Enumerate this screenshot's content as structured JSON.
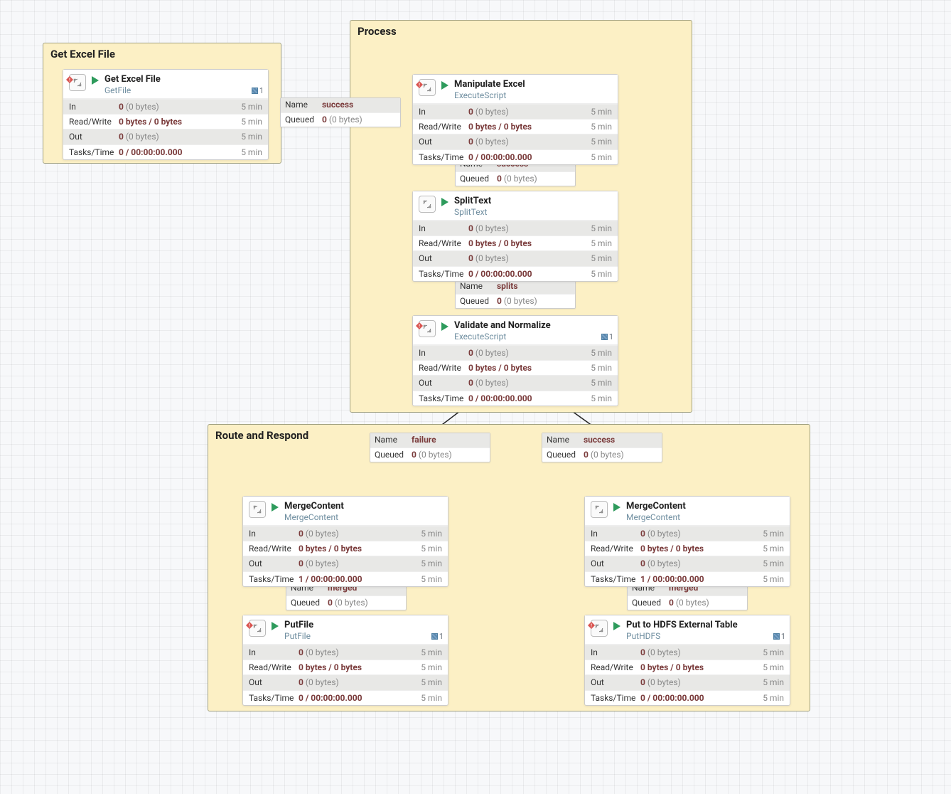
{
  "groups": {
    "get": {
      "title": "Get Excel File"
    },
    "process": {
      "title": "Process"
    },
    "route": {
      "title": "Route and Respond"
    }
  },
  "labels": {
    "fivemin": "5 min",
    "in": "In",
    "rw": "Read/Write",
    "out": "Out",
    "tt": "Tasks/Time",
    "name": "Name",
    "queued": "Queued"
  },
  "values": {
    "zero": "0",
    "zero_bytes": "(0 bytes)",
    "zero_slash": "0 bytes / 0 bytes",
    "tt0": "0 / 00:00:00.000",
    "tt1": "1 / 00:00:00.000"
  },
  "processors": {
    "getExcel": {
      "title": "Get Excel File",
      "sub": "GetFile",
      "warn": true,
      "badge": "1",
      "tt": "tt0"
    },
    "manipulate": {
      "title": "Manipulate Excel",
      "sub": "ExecuteScript",
      "warn": true,
      "badge": "",
      "tt": "tt0"
    },
    "splitText": {
      "title": "SplitText",
      "sub": "SplitText",
      "warn": false,
      "badge": "",
      "tt": "tt0"
    },
    "validate": {
      "title": "Validate and Normalize",
      "sub": "ExecuteScript",
      "warn": true,
      "badge": "1",
      "tt": "tt0"
    },
    "mergeL": {
      "title": "MergeContent",
      "sub": "MergeContent",
      "warn": false,
      "badge": "",
      "tt": "tt1"
    },
    "mergeR": {
      "title": "MergeContent",
      "sub": "MergeContent",
      "warn": false,
      "badge": "",
      "tt": "tt1"
    },
    "putFile": {
      "title": "PutFile",
      "sub": "PutFile",
      "warn": true,
      "badge": "1",
      "tt": "tt0"
    },
    "putHdfs": {
      "title": "Put to HDFS External Table",
      "sub": "PutHDFS",
      "warn": true,
      "badge": "1",
      "tt": "tt0"
    }
  },
  "connections": {
    "c1": {
      "name": "success"
    },
    "c2": {
      "name": "success"
    },
    "c3": {
      "name": "splits"
    },
    "cFail": {
      "name": "failure"
    },
    "cSucc": {
      "name": "success"
    },
    "cMergeL": {
      "name": "merged"
    },
    "cMergeR": {
      "name": "merged"
    }
  }
}
